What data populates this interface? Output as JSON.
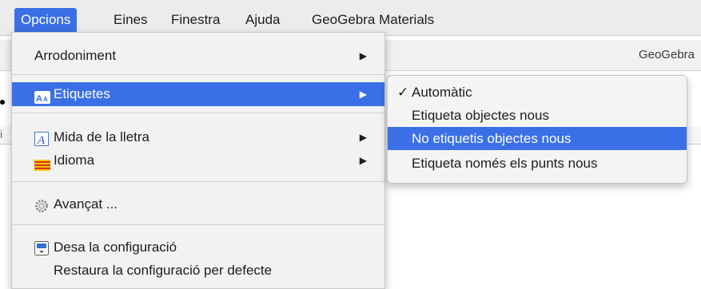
{
  "menubar": {
    "items": [
      "Opcions",
      "Eines",
      "Finestra",
      "Ajuda",
      "GeoGebra Materials"
    ]
  },
  "window": {
    "title": "GeoGebra",
    "fragment": "i"
  },
  "opcions_menu": {
    "items": [
      {
        "label": "Arrodoniment",
        "icon": "none",
        "submenu": true
      },
      {
        "label": "Etiquetes",
        "icon": "text-size-icon",
        "submenu": true,
        "selected": true
      },
      {
        "label": "Mida de la lletra",
        "icon": "font-icon",
        "submenu": true
      },
      {
        "label": "Idioma",
        "icon": "flag-icon",
        "submenu": true
      },
      {
        "label": "Avançat ...",
        "icon": "gear-icon",
        "submenu": false
      },
      {
        "label": "Desa la configuració",
        "icon": "save-icon",
        "submenu": false
      },
      {
        "label": "Restaura la configuració per defecte",
        "icon": "none",
        "submenu": false
      }
    ],
    "arrow_glyph": "▶"
  },
  "etiquetes_submenu": {
    "check_glyph": "✓",
    "items": [
      {
        "label": "Automàtic",
        "checked": true
      },
      {
        "label": "Etiqueta objectes nous"
      },
      {
        "label": "No etiquetis objectes nous",
        "selected": true
      },
      {
        "label": "Etiqueta només els punts nous"
      }
    ]
  },
  "colors": {
    "accent": "#3a6fe6",
    "menu_bg": "#f2f2f2",
    "menubar_bg": "#ececec"
  }
}
